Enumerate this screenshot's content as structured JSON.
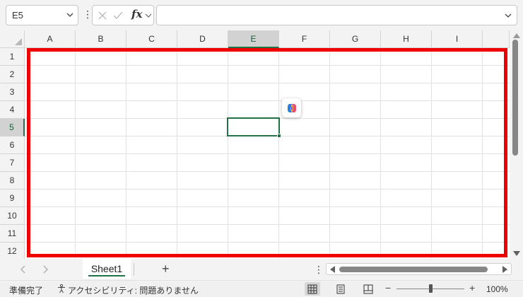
{
  "formula_bar": {
    "name_box": "E5",
    "formula": ""
  },
  "columns": [
    "A",
    "B",
    "C",
    "D",
    "E",
    "F",
    "G",
    "H",
    "I"
  ],
  "rows": [
    "1",
    "2",
    "3",
    "4",
    "5",
    "6",
    "7",
    "8",
    "9",
    "10",
    "11",
    "12"
  ],
  "active_cell": {
    "column": "E",
    "row": "5"
  },
  "highlight_color": "#ee0000",
  "accent_color": "#217346",
  "sheet_tabs": {
    "tabs": [
      {
        "label": "Sheet1",
        "active": true
      }
    ],
    "add_label": "+"
  },
  "status_bar": {
    "ready": "準備完了",
    "accessibility": "アクセシビリティ: 問題ありません",
    "zoom_minus": "−",
    "zoom_plus": "+",
    "zoom": "100%"
  }
}
